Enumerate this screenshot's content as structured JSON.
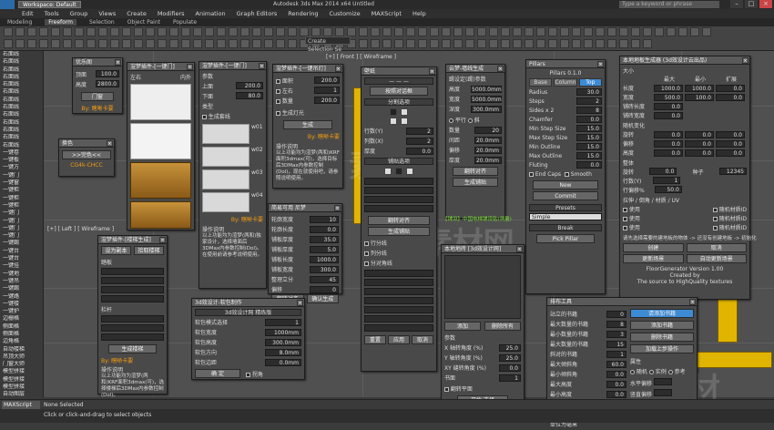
{
  "app": {
    "workspace": "Workspace: Default",
    "title": "Autodesk 3ds Max  2014 x64       Untitled",
    "keyword_placeholder": "Type a keyword or phrase"
  },
  "menu": [
    "Edit",
    "Tools",
    "Group",
    "Views",
    "Create",
    "Modifiers",
    "Animation",
    "Graph Editors",
    "Rendering",
    "Customize",
    "MAXScript",
    "Help"
  ],
  "ribbon": [
    "Modeling",
    "Freeform",
    "Selection",
    "Object Paint",
    "Populate"
  ],
  "ribbon_active": "Freeform",
  "toolbar": {
    "selection_set": "Create Selection Se"
  },
  "left_panel": [
    "右面线",
    "右面线",
    "右面线",
    "右面线",
    "右面线",
    "右面线",
    "右面线",
    "右面线",
    "右面线",
    "右面线",
    "右面线",
    "右面线",
    "右面线",
    "一键卷",
    "一键板",
    "一键方",
    "一键门",
    "一键窗",
    "一键柜",
    "一键柜",
    "一键柜",
    "一键门",
    "一键门",
    "一键门",
    "一键门",
    "一键踢",
    "一键台",
    "一键台",
    "一键挂",
    "一键地",
    "一键吊",
    "一键踢",
    "一键路",
    "一键楼",
    "一键护",
    "边栅格",
    "侧面格",
    "侧面格",
    "边角格",
    "自动楼梯",
    "吊顶大师",
    "门窗大师",
    "模型拼接",
    "模型拼接",
    "模型拼接",
    "自动图层",
    "CAD",
    "模型整理"
  ],
  "viewports": {
    "top_label": "[+] [ Top ] [ Wireframe ]",
    "front_label": "[+] [ Front ] [ Wireframe ]",
    "left_label": "[+] [ Left ] [ Wireframe ]"
  },
  "status": {
    "selected": "None Selected",
    "hint": "Click or click-and-drag to select objects",
    "script": "MAXScript Mi:"
  },
  "win_youhua": {
    "title": "优乐阁",
    "rows": [
      {
        "label": "顶面",
        "value": "100.0"
      },
      {
        "label": "高度",
        "value": "2800.0"
      }
    ],
    "btn": "门窗",
    "footer": "By: 瞎晰卡要"
  },
  "win_huanse": {
    "title": "换色",
    "btn": ">>完色<<",
    "code": "CG4k-CHCC"
  },
  "win_door_list": {
    "title": "渲梦插件-[一键门]",
    "left": "左右",
    "right": "内外"
  },
  "win_door2": {
    "title": "渲梦插件-[一键门]",
    "section": "参数",
    "top_label": "上面",
    "top_val": "200.0",
    "bottom_label": "下面",
    "bottom_val": "80.0",
    "type_label": "类型",
    "check": "生成套线",
    "row_labels": [
      "w01",
      "w02",
      "w03",
      "w04"
    ],
    "help_title": "操作说明",
    "help_text": "以上功能均为渲梦(两和)独家设计，选择墙面后3DMax内参数控制(Dol)。在使用前请参考说明使用。",
    "footer": "By: 瞎晰卡要"
  },
  "win_lamp": {
    "title": "渲梦插件-[一键吊灯]",
    "rows": [
      {
        "label": "面积",
        "value": "200.0"
      },
      {
        "label": "左右",
        "value": "1"
      },
      {
        "label": "数量",
        "value": "200.0"
      }
    ],
    "check": "生成灯光",
    "btn": "生成",
    "footer": "By: 瞎晰卡要",
    "help_title": "操作说明",
    "help_text": "以上功能均为渲梦(两和)KRF面积3dmax(可)，选择目标后3DMax内参数控制(Dol)，现在就使用吧，请参照说明使用。"
  },
  "win_stairs": {
    "title": "渲梦插件-[楼梯生成]",
    "btn": "设为副本",
    "pick": "拾取楼梯",
    "sec1": "踏板",
    "sec2": "栏杆",
    "sec3": "操作说明",
    "btn2": "生成楼梯",
    "footer": "By: 瞎晰卡要",
    "help": "以上功能均为渲梦(两和)KRF面积3dmax(可)，选择楼梯后3DMax内参数控制(Dol)。"
  },
  "win_simple": {
    "title": "简易可用 尼梦",
    "rows": [
      {
        "label": "轮廓宽度",
        "value": "10"
      },
      {
        "label": "轮廓长度",
        "value": "0.0"
      },
      {
        "label": "铺板厚度",
        "value": "35.0"
      },
      {
        "label": "铺板厚度",
        "value": "5.0"
      },
      {
        "label": "铺板长度",
        "value": "1000.0"
      },
      {
        "label": "铺板宽度",
        "value": "300.0"
      },
      {
        "label": "整理立分",
        "value": "45"
      },
      {
        "label": "偏移",
        "value": "0"
      }
    ],
    "btn1": "翻转对齐",
    "btn2": "确认生成"
  },
  "win_3ds": {
    "title": "3d效设计-软包制作",
    "header": "3d效设计网 精练版",
    "rows": [
      {
        "label": "软包模式选择",
        "value": "1"
      },
      {
        "label": "软包宽度",
        "value": "1000mm"
      },
      {
        "label": "软包高度",
        "value": "300.0mm"
      },
      {
        "label": "软包方向",
        "value": "8.0mm"
      },
      {
        "label": "软包边距",
        "value": "0.0mm"
      }
    ],
    "btn": "确 定",
    "check": "拐角"
  },
  "win_wall": {
    "title": "壁纸",
    "btn": "按照对话框",
    "sec": "分割选项",
    "sec2": "铺贴选项",
    "btn2": "翻转对齐",
    "btn3": "生成铺贴",
    "green": "【铺设】中国电梯铺设贴(测量)",
    "rows": [
      {
        "label": "行数(Y)",
        "value": "2"
      },
      {
        "label": "列数(X)",
        "value": "2"
      },
      {
        "label": "厚度",
        "value": "0.0"
      }
    ],
    "bottom": [
      "重置",
      "应用",
      "取消"
    ]
  },
  "win_create": {
    "title": "云梦-墙线生成",
    "header": "踢设定(踢)参数",
    "rows": [
      {
        "label": "高度",
        "value": "5000.0mm"
      },
      {
        "label": "宽度",
        "value": "5000.0mm"
      },
      {
        "label": "深度",
        "value": "300.0mm"
      }
    ],
    "radio": "平行",
    "rows2": [
      {
        "label": "数量",
        "value": "20"
      },
      {
        "label": "间距",
        "value": "20.0mm"
      },
      {
        "label": "偏移",
        "value": "20.0mm"
      },
      {
        "label": "厚度",
        "value": "20.0mm"
      }
    ],
    "btn": "翻转对齐",
    "btn2": "生成铺贴"
  },
  "win_pillars": {
    "title": "Pillars",
    "version": "Pillars 0.1.0",
    "tabs": [
      "Base",
      "Column",
      "Top"
    ],
    "rows": [
      {
        "label": "Radius",
        "value": "30.0"
      },
      {
        "label": "Steps",
        "value": "2"
      },
      {
        "label": "Sides x 2",
        "value": "8"
      },
      {
        "label": "Chamfer",
        "value": "0.0"
      },
      {
        "label": "Min Step Size",
        "value": "15.0"
      },
      {
        "label": "Max Step Size",
        "value": "15.0"
      },
      {
        "label": "Min Outline",
        "value": "15.0"
      },
      {
        "label": "Max Outline",
        "value": "15.0"
      },
      {
        "label": "Fluting",
        "value": "0.0"
      }
    ],
    "endcaps": "End Caps",
    "smooth": "Smooth",
    "btn_new": "New",
    "btn_commit": "Commit",
    "presets": "Presets",
    "preset_val": "Simple",
    "break": "Break",
    "pick": "Pick Pillar"
  },
  "win_floor": {
    "title": "本地地板生成器 (3d效设计云出品)",
    "sec1": "大小",
    "cols": [
      "最大",
      "最小",
      "扩展"
    ],
    "rows": [
      {
        "label": "长度",
        "v": [
          "1000.0",
          "1000.0",
          "0.0"
        ]
      },
      {
        "label": "宽度",
        "v": [
          "500.0",
          "100.0",
          "0.0"
        ]
      },
      {
        "label": "铺砖长度",
        "v": [
          "0.0",
          "",
          ""
        ]
      },
      {
        "label": "铺砖宽度",
        "v": [
          "0.0",
          "",
          ""
        ]
      }
    ],
    "sec2": "随机变化",
    "rows2": [
      {
        "label": "旋转",
        "v": [
          "0.0",
          "0.0",
          "0.0"
        ]
      },
      {
        "label": "偏移",
        "v": [
          "0.0",
          "0.0",
          "0.0"
        ]
      },
      {
        "label": "高度",
        "v": [
          "0.0",
          "0.0",
          "0.0"
        ]
      }
    ],
    "sec3": "整体",
    "seed_label": "种子",
    "seed": "12345",
    "rows3": [
      {
        "label": "旋转",
        "v": "0.0"
      },
      {
        "label": "行数(Y)",
        "v": "1"
      },
      {
        "label": "行偏移%",
        "v": "50.0"
      }
    ],
    "sec4": "拉伸 / 倒角 / 材质 / UV",
    "checks": [
      "使用",
      "使用",
      "使用"
    ],
    "checks2": [
      "随机材质ID",
      "随机材质ID",
      "随机材质ID"
    ],
    "help": "请先选择需要的建地板的物体 -> 还没有创建地板 -> 初始化",
    "btns": [
      "创建",
      "取消",
      "更新场景",
      "自动更新场景"
    ],
    "footer": "FloorGenerator Version 1.00",
    "footer2": "Created by",
    "footer3": "The source to HighQuality textures"
  },
  "win_local": {
    "title": "本地地砖 [3d效设计网]",
    "btn1": "添加",
    "btn2": "删除所有",
    "sec": "参数",
    "rows": [
      {
        "label": "X 轴转角度 (%)",
        "value": "25.0"
      },
      {
        "label": "Y 轴转角度 (%)",
        "value": "25.0"
      },
      {
        "label": "XY 缝转角度 (%)",
        "value": "0.0"
      },
      {
        "label": "书面",
        "value": "1"
      }
    ],
    "check": "翻转平面",
    "btn3": "开始 选择"
  },
  "win_layout": {
    "title": "排布工具",
    "rows": [
      {
        "label": "站立的书籍",
        "value": "0"
      },
      {
        "label": "最大数量的书籍",
        "value": "8"
      },
      {
        "label": "最小数量的书籍",
        "value": "3"
      },
      {
        "label": "最大数量的书籍",
        "value": "15"
      },
      {
        "label": "斜对的书籍",
        "value": "1"
      }
    ],
    "side_btns": [
      "请添加书籍",
      "添加书籍",
      "删除书籍",
      "加载上步操作"
    ],
    "rows2": [
      {
        "label": "最大倾斜角",
        "value": "60.0"
      },
      {
        "label": "最小倾斜角",
        "value": "0.0"
      },
      {
        "label": "最大高度",
        "value": "0.0"
      },
      {
        "label": "最小高度",
        "value": "0.0"
      },
      {
        "label": "最大角度",
        "value": "25.0"
      },
      {
        "label": "不同数量",
        "value": "0"
      }
    ],
    "sec": "属性",
    "side2": [
      "随机",
      "实例",
      "参考"
    ],
    "side3": [
      "水平偏移",
      "竖直偏移"
    ],
    "btn": "创建",
    "footer": "单位为毫米"
  }
}
